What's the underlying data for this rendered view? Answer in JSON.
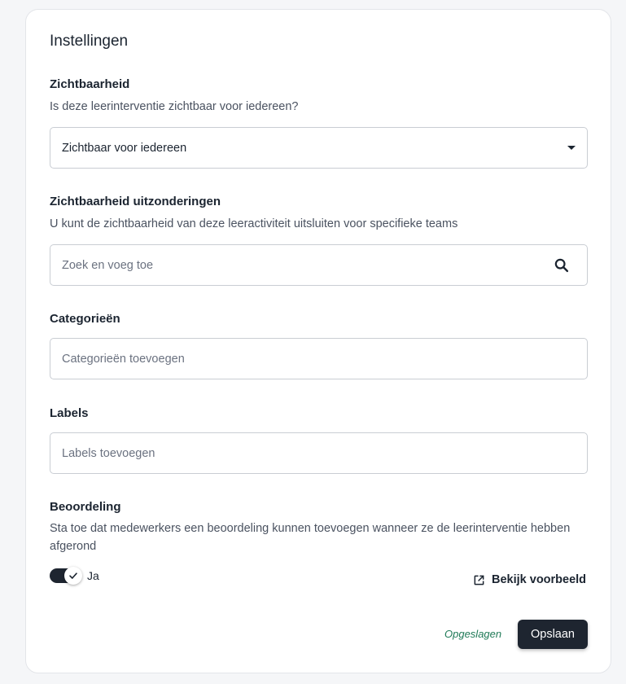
{
  "panel": {
    "title": "Instellingen"
  },
  "visibility": {
    "label": "Zichtbaarheid",
    "description": "Is deze leerinterventie zichtbaar voor iedereen?",
    "selected": "Zichtbaar voor iedereen"
  },
  "exceptions": {
    "label": "Zichtbaarheid uitzonderingen",
    "description": "U kunt de zichtbaarheid van deze leeractiviteit uitsluiten voor specifieke teams",
    "placeholder": "Zoek en voeg toe"
  },
  "categories": {
    "label": "Categorieën",
    "placeholder": "Categorieën toevoegen"
  },
  "labels": {
    "label": "Labels",
    "placeholder": "Labels toevoegen"
  },
  "rating": {
    "label": "Beoordeling",
    "description": "Sta toe dat medewerkers een beoordeling kunnen toevoegen wanneer ze de leerinterventie hebben afgerond",
    "toggle_label": "Ja",
    "toggle_on": true,
    "preview_link": "Bekijk voorbeeld"
  },
  "footer": {
    "status": "Opgeslagen",
    "save_label": "Opslaan"
  },
  "colors": {
    "primary": "#1e2530",
    "status_green": "#1f7a57"
  },
  "icons": {
    "dropdown": "caret-down-icon",
    "search": "search-icon",
    "toggle_check": "check-icon",
    "preview": "external-link-icon"
  }
}
